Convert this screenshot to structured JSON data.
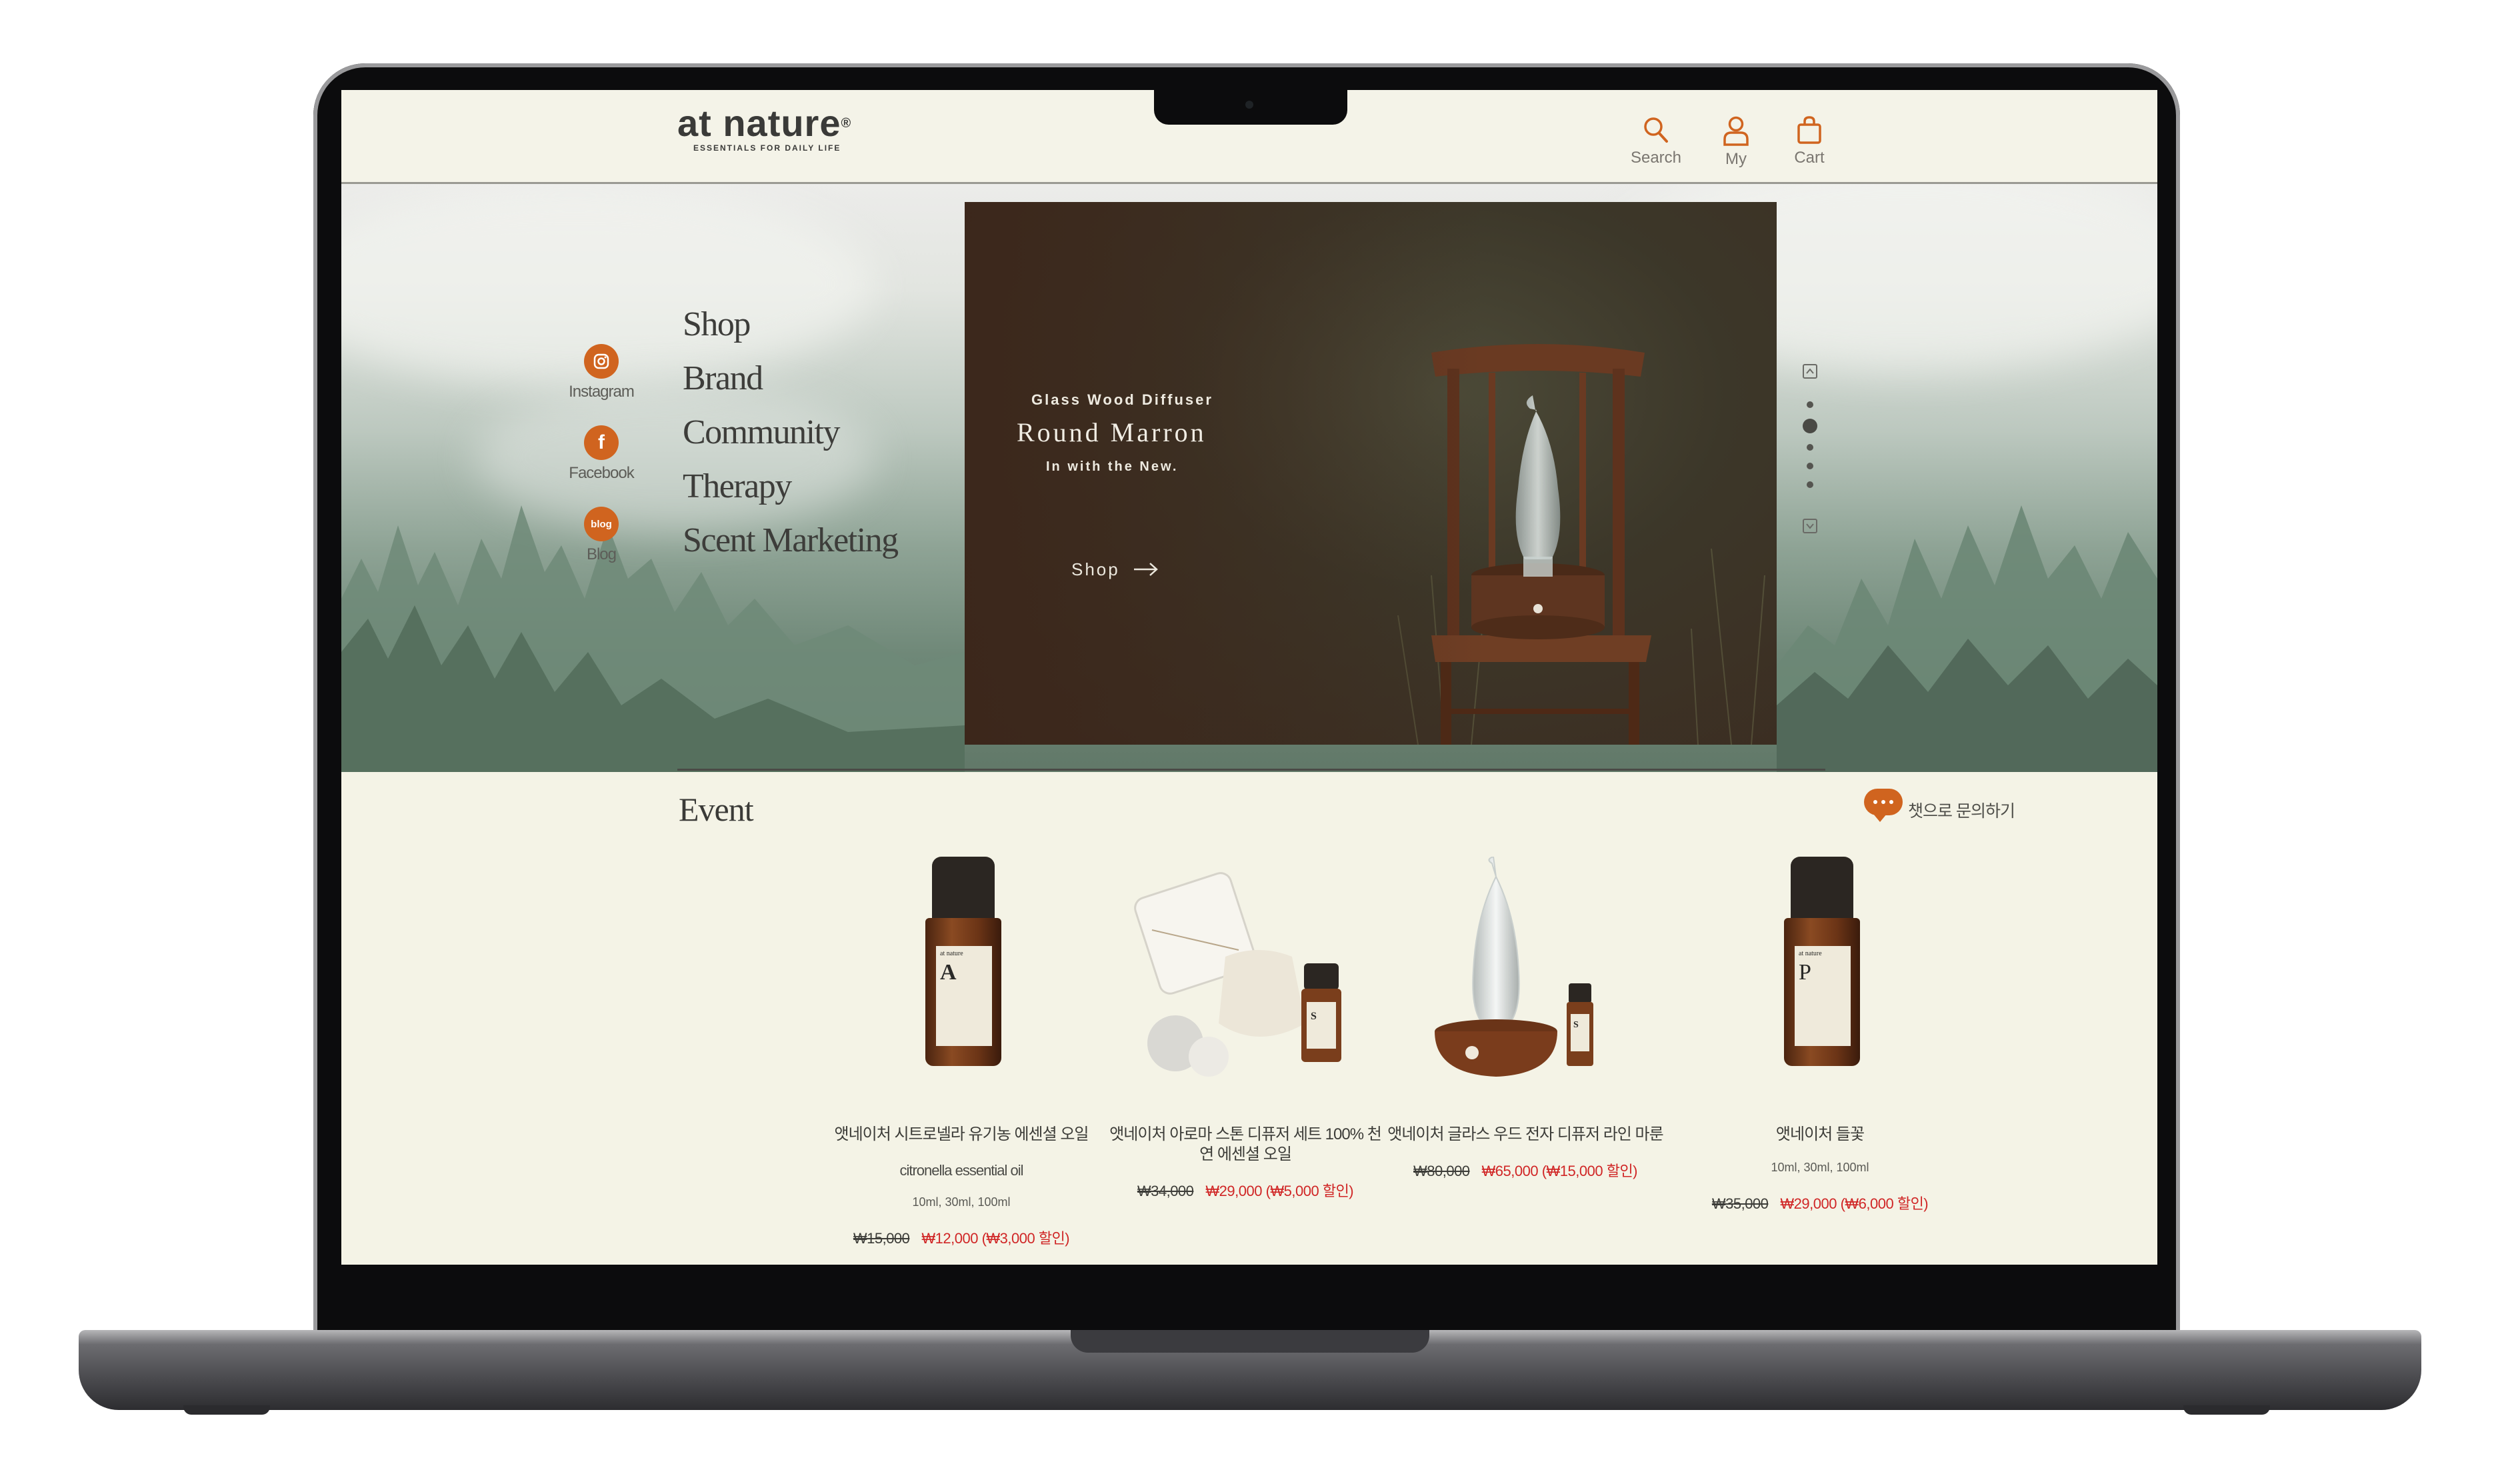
{
  "header": {
    "logo": "at nature",
    "logo_mark": "®",
    "tagline": "ESSENTIALS FOR DAILY LIFE",
    "search_label": "Search",
    "my_label": "My",
    "cart_label": "Cart"
  },
  "social": [
    {
      "label": "Instagram",
      "icon": "instagram-icon"
    },
    {
      "label": "Facebook",
      "icon": "facebook-icon"
    },
    {
      "label": "Blog",
      "icon": "blog-icon",
      "badge": "blog"
    }
  ],
  "menu": [
    "Shop",
    "Brand",
    "Community",
    "Therapy",
    "Scent Marketing"
  ],
  "banner": {
    "subtitle": "Glass Wood Diffuser",
    "title": "Round Marron",
    "tagline": "In with the New.",
    "cta": "Shop"
  },
  "pager": {
    "count": 5,
    "active_index": 1
  },
  "event": {
    "title": "Event",
    "chat_label": "챗으로 문의하기",
    "products": [
      {
        "name": "앳네이처 시트로넬라 유기농 에센셜 오일",
        "desc": "citronella essential oil",
        "volume": "10ml, 30ml, 100ml",
        "old_price": "₩15,000",
        "new_price": "₩12,000 (₩3,000 할인)",
        "label_letter": "A"
      },
      {
        "name": "앳네이처 아로마 스톤 디퓨저 세트 100% 천연 에센셜 오일",
        "desc": "",
        "volume": "",
        "old_price": "₩34,000",
        "new_price": "₩29,000 (₩5,000 할인)",
        "label_letter": "S"
      },
      {
        "name": "앳네이처 글라스 우드 전자 디퓨저 라인 마룬",
        "desc": "",
        "volume": "",
        "old_price": "₩80,000",
        "new_price": "₩65,000 (₩15,000 할인)",
        "label_letter": "S"
      },
      {
        "name": "앳네이처 들꽃",
        "desc": "",
        "volume": "10ml, 30ml, 100ml",
        "old_price": "₩35,000",
        "new_price": "₩29,000 (₩6,000 할인)",
        "label_letter": "P"
      }
    ]
  },
  "colors": {
    "accent": "#d0641f",
    "sale": "#d02626",
    "page_bg": "#f4f3e6"
  }
}
